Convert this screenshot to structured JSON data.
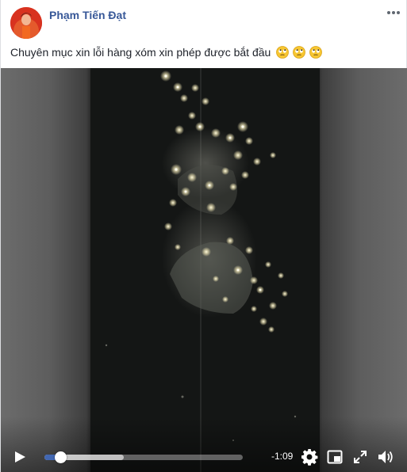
{
  "post": {
    "author": "Phạm Tiến Đạt",
    "caption": "Chuyên mục xin lỗi hàng xóm xin phép được bắt đầu",
    "emojis": [
      "rolling-eyes-emoji",
      "rolling-eyes-emoji",
      "rolling-eyes-emoji"
    ],
    "more_icon": "more-horizontal-icon"
  },
  "video": {
    "time_remaining": "-1:09",
    "progress_played": 0.08,
    "progress_buffered": 0.4,
    "icons": [
      "play-icon",
      "gear-icon",
      "picture-in-picture-icon",
      "fullscreen-icon",
      "volume-icon"
    ],
    "accent_color": "#4267b2"
  }
}
